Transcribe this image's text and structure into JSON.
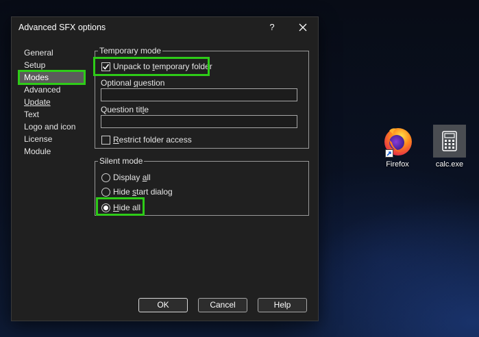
{
  "dialog": {
    "title": "Advanced SFX options",
    "help_glyph": "?",
    "close_glyph": "✕"
  },
  "nav": {
    "items": [
      {
        "label": "General",
        "selected": false
      },
      {
        "label": "Setup",
        "selected": false
      },
      {
        "label": "Modes",
        "selected": true
      },
      {
        "label": "Advanced",
        "selected": false
      },
      {
        "label": "Update",
        "selected": false,
        "underlined": true
      },
      {
        "label": "Text",
        "selected": false
      },
      {
        "label": "Logo and icon",
        "selected": false
      },
      {
        "label": "License",
        "selected": false
      },
      {
        "label": "Module",
        "selected": false
      }
    ]
  },
  "temporary_mode": {
    "legend": "Temporary mode",
    "unpack_label_pre": "Unpack to ",
    "unpack_label_key": "t",
    "unpack_label_post": "emporary folder",
    "unpack_checked": true,
    "optional_question_label_pre": "Optional ",
    "optional_question_label_key": "q",
    "optional_question_label_post": "uestion",
    "optional_question_value": "",
    "question_title_label_pre": "Question tit",
    "question_title_label_key": "l",
    "question_title_label_post": "e",
    "question_title_value": "",
    "restrict_label_key": "R",
    "restrict_label_post": "estrict folder access",
    "restrict_checked": false
  },
  "silent_mode": {
    "legend": "Silent mode",
    "options": [
      {
        "pre": "Display ",
        "key": "a",
        "post": "ll",
        "selected": false
      },
      {
        "pre": "Hide ",
        "key": "s",
        "post": "tart dialog",
        "selected": false
      },
      {
        "pre": "",
        "key": "H",
        "post": "ide all",
        "selected": true
      }
    ]
  },
  "buttons": {
    "ok": "OK",
    "cancel": "Cancel",
    "help": "Help"
  },
  "desktop": {
    "icons": [
      {
        "label": "Firefox",
        "icon": "firefox-icon",
        "shortcut": true
      },
      {
        "label": "calc.exe",
        "icon": "calculator-icon",
        "shortcut": false
      }
    ]
  },
  "colors": {
    "highlight": "#2ecc18",
    "dialog_bg": "#202020",
    "selected_nav_bg": "#5b5b5b"
  }
}
